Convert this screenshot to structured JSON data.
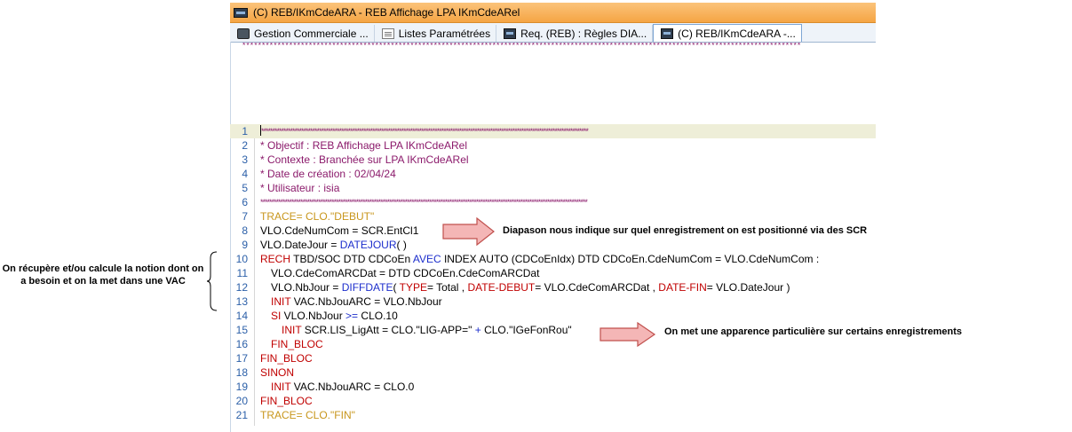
{
  "window": {
    "title": "(C) REB/IKmCdeARA - REB Affichage LPA IKmCdeARel"
  },
  "tabs": [
    {
      "label": "Gestion Commerciale ...",
      "icon": "database-icon"
    },
    {
      "label": "Listes Paramétrées",
      "icon": "document-icon"
    },
    {
      "label": "Req. (REB) : Règles DIA...",
      "icon": "screen-icon"
    },
    {
      "label": "(C) REB/IKmCdeARA -...",
      "icon": "screen-icon",
      "active": true
    }
  ],
  "top_stars": "***************************************************************************************************************************************************",
  "code": {
    "numbers": [
      "1",
      "2",
      "3",
      "4",
      "5",
      "6",
      "7",
      "8",
      "9",
      "10",
      "11",
      "12",
      "13",
      "14",
      "15",
      "16",
      "17",
      "18",
      "19",
      "20",
      "21"
    ],
    "l1": "***************************************************************************************************************************************************",
    "l2": "* Objectif : REB Affichage LPA IKmCdeARel",
    "l3": "* Contexte : Branchée sur LPA IKmCdeARel",
    "l4": "* Date de création : 02/04/24",
    "l5": "* Utilisateur : isia",
    "l6": "***************************************************************************************************************************************************",
    "l7": "TRACE= CLO.\"DEBUT\"",
    "l8": "VLO.CdeNumCom = SCR.EntCl1",
    "l9a": "VLO.DateJour = ",
    "l9b": "DATEJOUR",
    "l9c": "( )",
    "l10a": "RECH",
    "l10b": " TBD/SOC DTD CDCoEn ",
    "l10c": "AVEC",
    "l10d": " INDEX AUTO (CDCoEnIdx) DTD CDCoEn.CdeNumCom = VLO.CdeNumCom :",
    "l11": "VLO.CdeComARCDat = DTD CDCoEn.CdeComARCDat",
    "l12a": "VLO.NbJour = ",
    "l12b": "DIFFDATE",
    "l12c": "( ",
    "l12d": "TYPE",
    "l12e": "= Total , ",
    "l12f": "DATE-DEBUT",
    "l12g": "= VLO.CdeComARCDat , ",
    "l12h": "DATE-FIN",
    "l12i": "= VLO.DateJour )",
    "l13a": "INIT",
    "l13b": " VAC.NbJouARC = VLO.NbJour",
    "l14a": "SI",
    "l14b": " VLO.NbJour ",
    "l14c": ">=",
    "l14d": " CLO.10",
    "l15a": "INIT",
    "l15b": " SCR.LIS_LigAtt = CLO.\"LIG-APP=\" ",
    "l15c": "+",
    "l15d": " CLO.\"IGeFonRou\"",
    "l16": "FIN_BLOC",
    "l17": "FIN_BLOC",
    "l18": "SINON",
    "l19a": "INIT",
    "l19b": " VAC.NbJouARC = CLO.0",
    "l20": "FIN_BLOC",
    "l21": "TRACE= CLO.\"FIN\""
  },
  "annotations": {
    "note1": "Diapason nous indique sur quel enregistrement on est positionné via des SCR",
    "note2": "On met une apparence particulière sur certains enregistrements",
    "left_note": "On récupère et/ou calcule la notion dont on a besoin et on la met dans une VAC"
  },
  "colors": {
    "comment": "#8b1a6b",
    "trace": "#c8961c",
    "keyword": "#c00000",
    "function": "#1c2ecc",
    "line_number": "#2b5fa8",
    "arrow_fill": "#f4b6b6",
    "arrow_stroke": "#c0504d"
  }
}
